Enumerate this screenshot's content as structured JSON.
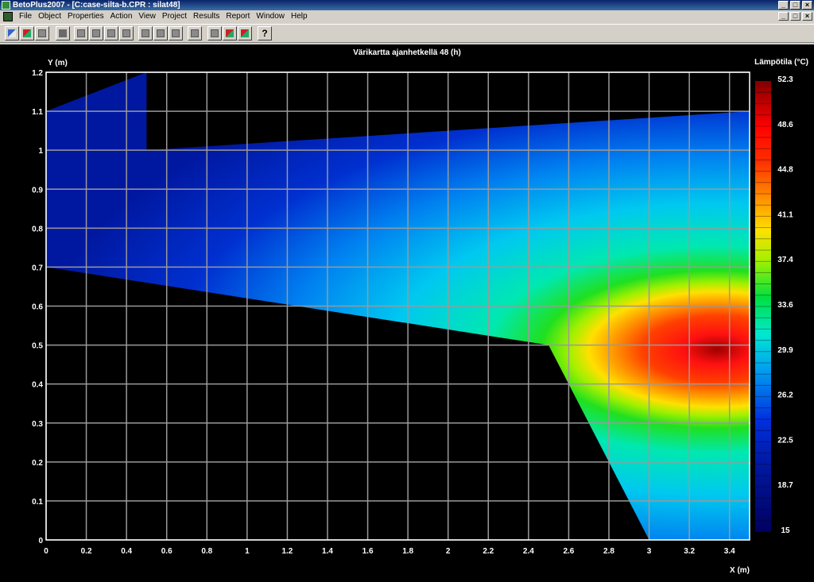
{
  "window": {
    "title": "BetoPlus2007 - [C:case-silta-b.CPR : silat48]",
    "buttons": [
      "_",
      "□",
      "×"
    ]
  },
  "menu": [
    "File",
    "Object",
    "Properties",
    "Action",
    "View",
    "Project",
    "Results",
    "Report",
    "Window",
    "Help"
  ],
  "toolbar": {
    "icons": [
      "new-object-icon",
      "open-icon",
      "copy-icon",
      "print-icon",
      "view1-icon",
      "view2-icon",
      "view3-icon",
      "view4-icon",
      "view5-icon",
      "view6-icon",
      "view7-icon",
      "export-icon",
      "zoom-icon",
      "chart-icon",
      "close-chart-icon",
      "help-icon"
    ],
    "help_label": "?"
  },
  "chart_data": {
    "type": "heatmap",
    "title": "Värikartta ajanhetkellä 48 (h)",
    "xlabel": "X (m)",
    "ylabel": "Y (m)",
    "xlim": [
      0,
      3.5
    ],
    "ylim": [
      0,
      1.2
    ],
    "x_ticks": [
      0,
      0.2,
      0.4,
      0.6,
      0.8,
      1,
      1.2,
      1.4,
      1.6,
      1.8,
      2,
      2.2,
      2.4,
      2.6,
      2.8,
      3,
      3.2,
      3.4
    ],
    "y_ticks": [
      0,
      0.1,
      0.2,
      0.3,
      0.4,
      0.5,
      0.6,
      0.7,
      0.8,
      0.9,
      1,
      1.1,
      1.2
    ],
    "grid": true,
    "colorbar": {
      "title": "Lämpötila (°C)",
      "min": 15,
      "max": 52.3,
      "tick_labels": [
        "52.3",
        "48.6",
        "44.8",
        "41.1",
        "37.4",
        "33.6",
        "29.9",
        "26.2",
        "22.5",
        "18.7",
        "15"
      ]
    },
    "domain_outline": [
      [
        0,
        1.1
      ],
      [
        0.5,
        1.2
      ],
      [
        0.5,
        1.0
      ],
      [
        3.5,
        1.1
      ],
      [
        3.5,
        0
      ],
      [
        3.0,
        0
      ],
      [
        2.5,
        0.5
      ],
      [
        0,
        0.7
      ]
    ],
    "hot_spot": {
      "x": 3.4,
      "y": 0.5,
      "value": 52.3
    }
  }
}
